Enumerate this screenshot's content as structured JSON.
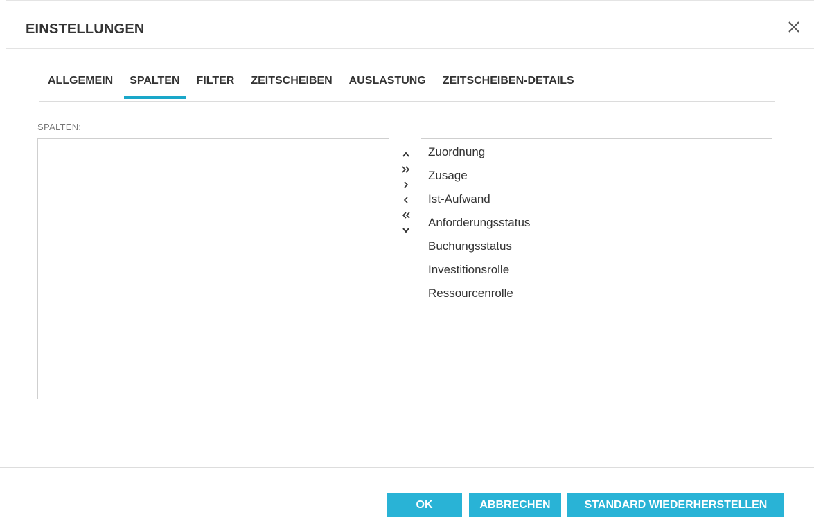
{
  "dialog": {
    "title": "EINSTELLUNGEN",
    "close_icon": "close-icon"
  },
  "tabs": [
    {
      "label": "ALLGEMEIN",
      "active": false
    },
    {
      "label": "SPALTEN",
      "active": true
    },
    {
      "label": "FILTER",
      "active": false
    },
    {
      "label": "ZEITSCHEIBEN",
      "active": false
    },
    {
      "label": "AUSLASTUNG",
      "active": false
    },
    {
      "label": "ZEITSCHEIBEN-DETAILS",
      "active": false
    }
  ],
  "columns": {
    "label": "SPALTEN:",
    "available_items": [],
    "selected_items": [
      "Zuordnung",
      "Zusage",
      "Ist-Aufwand",
      "Anforderungsstatus",
      "Buchungsstatus",
      "Investitionsrolle",
      "Ressourcenrolle"
    ]
  },
  "arrows": {
    "move_up_icon": "chevron-up-icon",
    "move_all_right_icon": "double-chevron-right-icon",
    "move_right_icon": "chevron-right-icon",
    "move_left_icon": "chevron-left-icon",
    "move_all_left_icon": "double-chevron-left-icon",
    "move_down_icon": "chevron-down-icon"
  },
  "footer": {
    "ok_label": "OK",
    "cancel_label": "ABBRECHEN",
    "reset_label": "STANDARD WIEDERHERSTELLEN"
  },
  "colors": {
    "accent": "#29b3d6",
    "tab_underline": "#1aa7c9",
    "text": "#333333",
    "border": "#cfcfcf"
  }
}
